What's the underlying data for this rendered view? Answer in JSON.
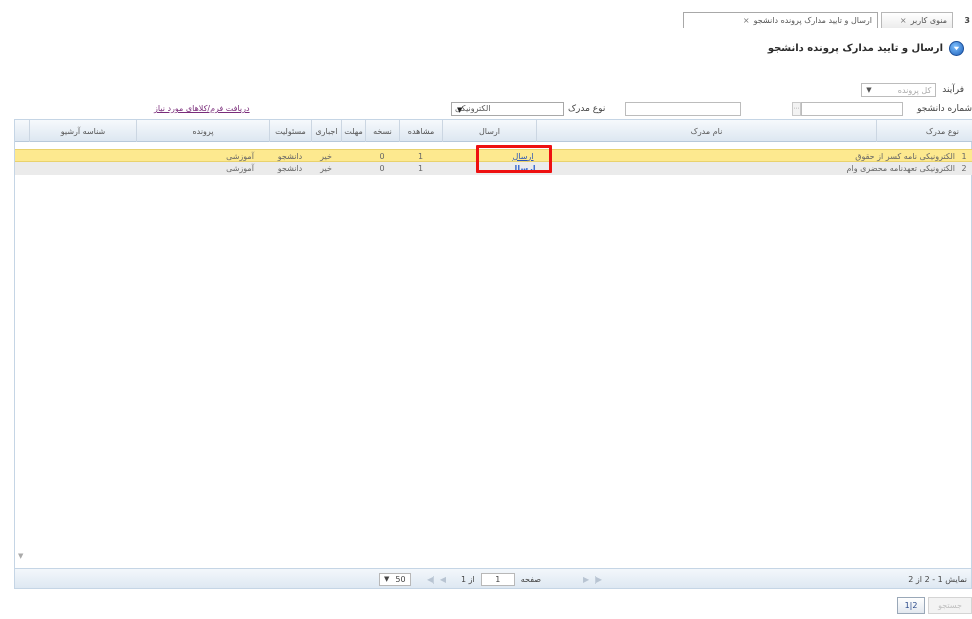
{
  "tabs": [
    {
      "label": "ارسال و تایید مدارک پرونده دانشجو",
      "close": "×",
      "active": true
    },
    {
      "label": "منوی کاربر",
      "close": "×",
      "active": false
    }
  ],
  "home_tab": "3",
  "heading": {
    "title": "ارسال و تایید مدارک پرونده دانشجو"
  },
  "filters": {
    "process_label": "فرآیند",
    "process_placeholder": "کل پرونده",
    "student_no_label": "شماره دانشجو",
    "doc_type_label": "نوع مدرک",
    "doc_type_value": "الکترونیکی",
    "report_link": "دریافت فرم/کلاهای مورد نیاز"
  },
  "grid": {
    "columns": {
      "doc_type": "نوع مدرک",
      "doc_name": "نام مدرک",
      "send": "ارسال",
      "deadline_status": "مشاهده",
      "copy_count": "نسخه",
      "deadline": "مهلت",
      "mandatory": "اجباری",
      "responsible": "مسئولیت",
      "file": "پرونده",
      "archive_id": "شناسه آرشیو"
    },
    "rows": [
      {
        "num": "1",
        "doc_type": "الکترونیکی",
        "doc_name": "نامه کسر از حقوق",
        "send": "ارسال",
        "view": "1",
        "copy": "0",
        "mandatory": "خیر",
        "responsible": "دانشجو",
        "file": "آموزشی",
        "archive_id": ""
      },
      {
        "num": "2",
        "doc_type": "الکترونیکی",
        "doc_name": "تعهدنامه محضری وام",
        "send": "ارسال",
        "view": "1",
        "copy": "0",
        "mandatory": "خیر",
        "responsible": "دانشجو",
        "file": "آموزشی",
        "archive_id": ""
      }
    ]
  },
  "pager": {
    "summary": "نمایش 1 - 2 از 2",
    "page_label": "صفحه",
    "page_value": "1",
    "of_label": "از 1",
    "page_size": "50"
  },
  "toolbar": {
    "btn1": "جستجو",
    "btn2": "1|2"
  }
}
